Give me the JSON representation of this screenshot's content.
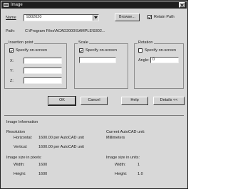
{
  "window": {
    "title": "Image"
  },
  "name_row": {
    "label": "Name",
    "value": "9302020",
    "browse_label": "Browse...",
    "retain_path_label": "Retain Path",
    "retain_path_checked": true
  },
  "path_row": {
    "label": "Path:",
    "value": "C:\\Program Files\\ACAD2000\\SAMPLE\\9302..."
  },
  "insertion_point": {
    "title": "Insertion point",
    "specify_label": "Specify on-screen",
    "specify_checked": true,
    "x_label": "X:",
    "x_value": "",
    "y_label": "Y:",
    "y_value": "",
    "z_label": "Z:",
    "z_value": ""
  },
  "scale": {
    "title": "Scale",
    "specify_label": "Specify on-screen",
    "specify_checked": true,
    "value": ""
  },
  "rotation": {
    "title": "Rotation",
    "specify_label": "Specify on-screen",
    "specify_checked": false,
    "angle_label": "Angle:",
    "angle_value": "0"
  },
  "buttons": {
    "ok": "OK",
    "cancel": "Cancel",
    "help": "Help",
    "details": "Details <<"
  },
  "image_info": {
    "title": "Image Information",
    "resolution_label": "Resolution",
    "horizontal_label": "Horizontal:",
    "horizontal_value": "1600.00 per AutoCAD unit",
    "vertical_label": "Vertical:",
    "vertical_value": "1600.00 per AutoCAD unit",
    "current_unit_label": "Current AutoCAD unit:",
    "current_unit_value": "Millimeters",
    "size_pixels_label": "Image size in pixels:",
    "width_px_label": "Width:",
    "width_px_value": "1600",
    "height_px_label": "Height:",
    "height_px_value": "1600",
    "size_units_label": "Image size in units:",
    "width_units_label": "Width:",
    "width_units_value": "1",
    "height_units_label": "Height:",
    "height_units_value": "1.0"
  }
}
